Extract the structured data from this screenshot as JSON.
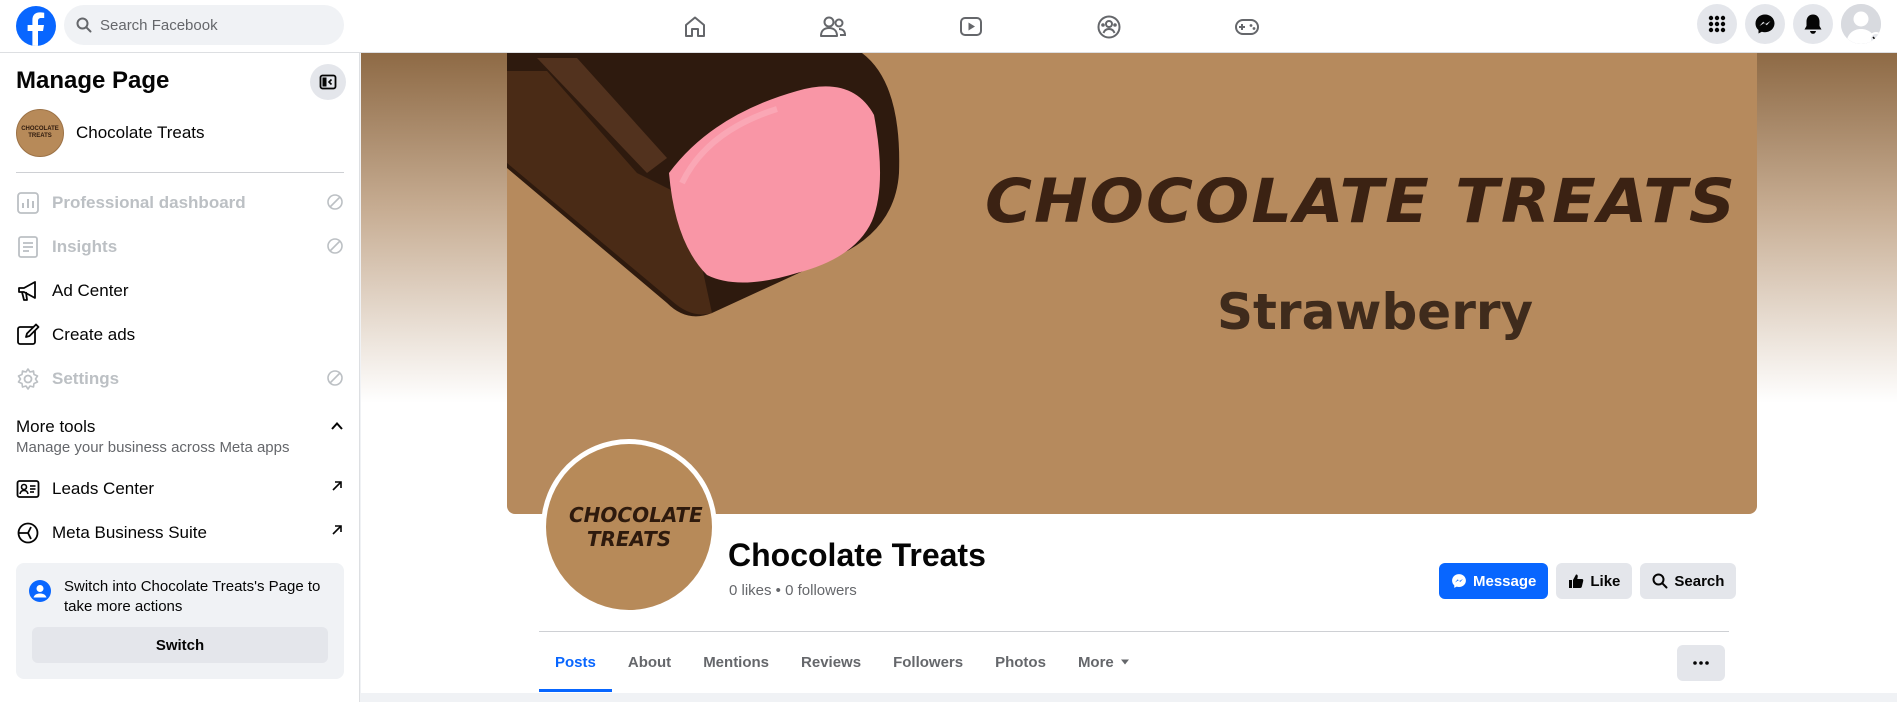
{
  "topbar": {
    "search": {
      "placeholder": "Search Facebook"
    },
    "nav_icons": [
      "home-icon",
      "friends-icon",
      "watch-icon",
      "groups-icon",
      "gaming-icon"
    ],
    "right_icons": [
      "menu-grid-icon",
      "messenger-icon",
      "notifications-icon",
      "account-avatar"
    ]
  },
  "sidebar": {
    "title": "Manage Page",
    "page_name": "Chocolate Treats",
    "page_avatar_text": "CHOCOLATE TREATS",
    "items": [
      {
        "label": "Professional dashboard",
        "icon": "dashboard-icon",
        "disabled": true
      },
      {
        "label": "Insights",
        "icon": "insights-icon",
        "disabled": true
      },
      {
        "label": "Ad Center",
        "icon": "megaphone-icon",
        "disabled": false
      },
      {
        "label": "Create ads",
        "icon": "edit-icon",
        "disabled": false
      },
      {
        "label": "Settings",
        "icon": "gear-icon",
        "disabled": true
      }
    ],
    "more_tools": {
      "title": "More tools",
      "subtitle": "Manage your business across Meta apps",
      "items": [
        {
          "label": "Leads Center",
          "icon": "id-card-icon"
        },
        {
          "label": "Meta Business Suite",
          "icon": "meta-suite-icon"
        }
      ]
    },
    "switch_card": {
      "text": "Switch into Chocolate Treats's Page to take more actions",
      "button": "Switch"
    }
  },
  "profile": {
    "cover_title": "CHOCOLATE TREATS",
    "cover_subtitle": "Strawberry",
    "avatar_text": "CHOCOLATE TREATS",
    "name": "Chocolate Treats",
    "stats": "0 likes • 0 followers",
    "actions": {
      "message": "Message",
      "like": "Like",
      "search": "Search"
    },
    "tabs": [
      "Posts",
      "About",
      "Mentions",
      "Reviews",
      "Followers",
      "Photos",
      "More"
    ],
    "active_tab": "Posts"
  },
  "colors": {
    "accent": "#0866ff",
    "cover": "#b68a5d",
    "chocolate": "#3b2213",
    "strawberry": "#f996a6"
  }
}
